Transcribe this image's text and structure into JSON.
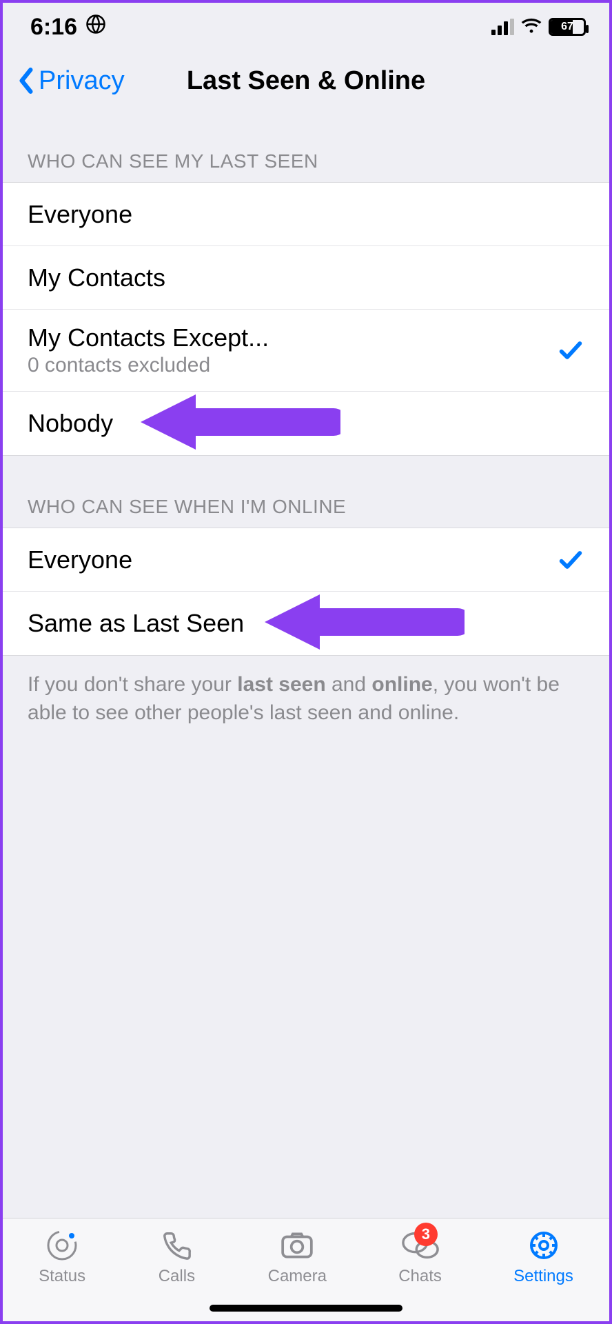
{
  "status": {
    "time": "6:16",
    "battery": "67",
    "battery_fill_pct": 67
  },
  "nav": {
    "back_label": "Privacy",
    "title": "Last Seen & Online"
  },
  "section_last_seen": {
    "header": "WHO CAN SEE MY LAST SEEN",
    "options": [
      {
        "label": "Everyone",
        "sub": "",
        "checked": false
      },
      {
        "label": "My Contacts",
        "sub": "",
        "checked": false
      },
      {
        "label": "My Contacts Except...",
        "sub": "0 contacts excluded",
        "checked": true
      },
      {
        "label": "Nobody",
        "sub": "",
        "checked": false
      }
    ]
  },
  "section_online": {
    "header": "WHO CAN SEE WHEN I'M ONLINE",
    "options": [
      {
        "label": "Everyone",
        "sub": "",
        "checked": true
      },
      {
        "label": "Same as Last Seen",
        "sub": "",
        "checked": false
      }
    ]
  },
  "footer": {
    "pre": "If you don't share your ",
    "b1": "last seen",
    "mid": " and ",
    "b2": "online",
    "post": ", you won't be able to see other people's last seen and online."
  },
  "tabs": {
    "status": "Status",
    "calls": "Calls",
    "camera": "Camera",
    "chats": "Chats",
    "settings": "Settings",
    "chats_badge": "3"
  },
  "colors": {
    "accent": "#007aff",
    "annotation": "#8a3ff0",
    "badge": "#ff3b30"
  }
}
